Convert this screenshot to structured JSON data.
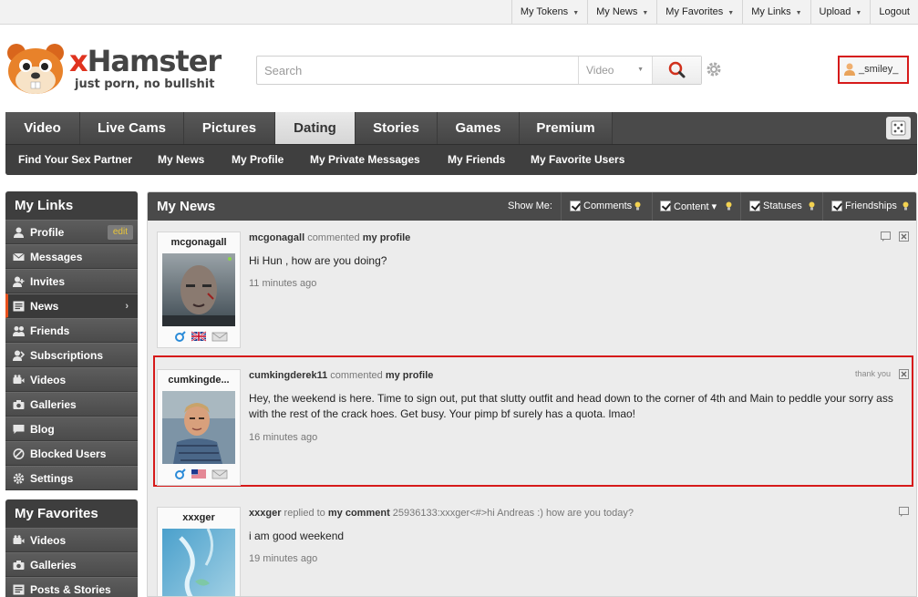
{
  "topbar": {
    "items": [
      {
        "label": "My Tokens",
        "dropdown": true
      },
      {
        "label": "My News",
        "dropdown": true
      },
      {
        "label": "My Favorites",
        "dropdown": true
      },
      {
        "label": "My Links",
        "dropdown": true
      },
      {
        "label": "Upload",
        "dropdown": true
      },
      {
        "label": "Logout",
        "dropdown": false
      }
    ]
  },
  "logo": {
    "brand_x": "x",
    "brand_rest": "Hamster",
    "tagline": "just porn, no bullshit"
  },
  "search": {
    "placeholder": "Search",
    "type_value": "Video"
  },
  "user": {
    "name": "_smiley_"
  },
  "nav": {
    "tabs": [
      "Video",
      "Live Cams",
      "Pictures",
      "Dating",
      "Stories",
      "Games",
      "Premium"
    ],
    "active_tab": "Dating",
    "subnav": [
      "Find Your Sex Partner",
      "My News",
      "My Profile",
      "My Private Messages",
      "My Friends",
      "My Favorite Users"
    ]
  },
  "sidebar": {
    "links_title": "My Links",
    "links": [
      {
        "label": "Profile",
        "icon": "user-icon",
        "badge": "edit"
      },
      {
        "label": "Messages",
        "icon": "envelope-icon"
      },
      {
        "label": "Invites",
        "icon": "invite-icon"
      },
      {
        "label": "News",
        "icon": "news-icon",
        "active": true,
        "chevron": "›"
      },
      {
        "label": "Friends",
        "icon": "friends-icon"
      },
      {
        "label": "Subscriptions",
        "icon": "subscriptions-icon"
      },
      {
        "label": "Videos",
        "icon": "camera-icon"
      },
      {
        "label": "Galleries",
        "icon": "photo-camera-icon"
      },
      {
        "label": "Blog",
        "icon": "blog-icon"
      },
      {
        "label": "Blocked Users",
        "icon": "blocked-icon"
      },
      {
        "label": "Settings",
        "icon": "gear-icon"
      }
    ],
    "favorites_title": "My Favorites",
    "favorites": [
      {
        "label": "Videos",
        "icon": "camera-icon"
      },
      {
        "label": "Galleries",
        "icon": "photo-camera-icon"
      },
      {
        "label": "Posts & Stories",
        "icon": "posts-icon"
      }
    ]
  },
  "news": {
    "title": "My News",
    "show_me": "Show Me:",
    "filters": [
      {
        "label": "Comments",
        "checked": true
      },
      {
        "label": "Content",
        "checked": true,
        "dropdown": true
      },
      {
        "label": "Statuses",
        "checked": true
      },
      {
        "label": "Friendships",
        "checked": true
      }
    ],
    "posts": [
      {
        "user": "mcgonagall",
        "action": "commented",
        "target": "my profile",
        "extra": "",
        "text": "Hi Hun , how are you doing?",
        "time": "11 minutes ago",
        "flag": "UK"
      },
      {
        "user_short": "cumkingde...",
        "user": "cumkingderek11",
        "action": "commented",
        "target": "my profile",
        "extra": "",
        "text": "Hey, the weekend is here. Time to sign out, put that slutty outfit and head down to the corner of 4th and Main to peddle your sorry ass with the rest of the crack hoes. Get busy. Your pimp bf surely has a quota. lmao!",
        "time": "16 minutes ago",
        "thank_you": "thank you",
        "flag": "US"
      },
      {
        "user": "xxxger",
        "action": "replied to",
        "target": "my comment",
        "extra": "25936133:xxxger<#>hi Andreas :) how are you today?",
        "text": "i am good weekend",
        "time": "19 minutes ago"
      }
    ]
  },
  "colors": {
    "accent_red": "#d61a1a",
    "nav_dark": "#4a4a4a",
    "active_marker": "#e8501c"
  }
}
